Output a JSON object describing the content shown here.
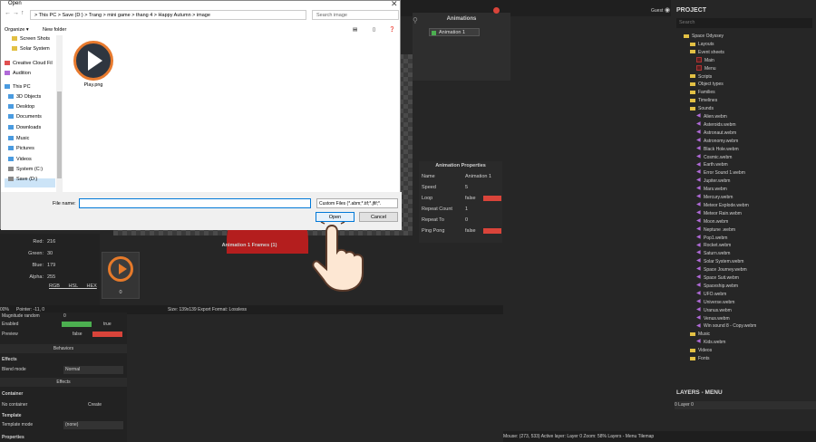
{
  "dialog": {
    "title": "Open",
    "address": "  >  This PC  >  Save (D:)  >  Trang  >  mini game  >  thang 4  >  Happy Autumn  >  image",
    "search_placeholder": "Search image",
    "organize": "Organize ▾",
    "new_folder": "New folder",
    "file_name_label": "File name:",
    "file_type": "Custom Files (*.abm;*.tif;*.jfif;*.",
    "open": "Open",
    "cancel": "Cancel",
    "file": "Play.png"
  },
  "nav_items": [
    "Screen Shots",
    "Solar System",
    "Creative Cloud Fil",
    "Audition",
    "This PC",
    "3D Objects",
    "Desktop",
    "Documents",
    "Downloads",
    "Music",
    "Pictures",
    "Videos",
    "System (C:)",
    "Save (D:)"
  ],
  "animations": {
    "title": "Animations",
    "item": "Animation 1"
  },
  "anim_props": {
    "title": "Animation Properties",
    "rows": [
      [
        "Name",
        "Animation 1"
      ],
      [
        "Speed",
        "5"
      ],
      [
        "Loop",
        "false"
      ],
      [
        "Repeat Count",
        "1"
      ],
      [
        "Repeat To",
        "0"
      ],
      [
        "Ping Pong",
        "false"
      ]
    ]
  },
  "frames": {
    "title": "Animation 1 Frames (1)",
    "frame_num": "0"
  },
  "color": {
    "red_l": "Red:",
    "red": "216",
    "green_l": "Green:",
    "green": "30",
    "blue_l": "Blue:",
    "blue": "179",
    "alpha_l": "Alpha:",
    "alpha": "255",
    "tabs": "RGB HSL HEX"
  },
  "status": {
    "zoom": "00%",
    "pointer": "Pointer: -11, 0",
    "size": "Size: 139x139   Export Format: Lossless"
  },
  "props": {
    "magnitude": "Magnitude random",
    "mag_v": "0",
    "enabled": "Enabled",
    "enabled_v": "true",
    "preview": "Preview",
    "preview_v": "false",
    "behaviors": "Behaviors",
    "effects": "Effects",
    "blend": "Blend mode",
    "blend_v": "Normal",
    "effects2": "Effects",
    "container": "Container",
    "no_container": "No container",
    "create": "Create",
    "template": "Template",
    "template_mode": "Template mode",
    "template_v": "(none)",
    "properties": "Properties"
  },
  "project": {
    "title": "PROJECT",
    "search": "Search",
    "tree": [
      [
        "f",
        0,
        "Space Odyssey"
      ],
      [
        "f",
        1,
        "Layouts"
      ],
      [
        "f",
        1,
        "Event sheets"
      ],
      [
        "l",
        2,
        "Main"
      ],
      [
        "l",
        2,
        "Menu"
      ],
      [
        "f",
        1,
        "Scripts"
      ],
      [
        "f",
        1,
        "Object types"
      ],
      [
        "f",
        1,
        "Families"
      ],
      [
        "f",
        1,
        "Timelines"
      ],
      [
        "f",
        1,
        "Sounds"
      ],
      [
        "s",
        2,
        "Alien.webm"
      ],
      [
        "s",
        2,
        "Asteroids.webm"
      ],
      [
        "s",
        2,
        "Astronaut.webm"
      ],
      [
        "s",
        2,
        "Astronomy.webm"
      ],
      [
        "s",
        2,
        "Black Hole.webm"
      ],
      [
        "s",
        2,
        "Cosmic.webm"
      ],
      [
        "s",
        2,
        "Earth.webm"
      ],
      [
        "s",
        2,
        "Error Sound 1.webm"
      ],
      [
        "s",
        2,
        "Jupiter.webm"
      ],
      [
        "s",
        2,
        "Mars.webm"
      ],
      [
        "s",
        2,
        "Mercury.webm"
      ],
      [
        "s",
        2,
        "Meteor Explode.webm"
      ],
      [
        "s",
        2,
        "Meteor Rain.webm"
      ],
      [
        "s",
        2,
        "Moon.webm"
      ],
      [
        "s",
        2,
        "Neptune .webm"
      ],
      [
        "s",
        2,
        "Pop1.webm"
      ],
      [
        "s",
        2,
        "Rocket.webm"
      ],
      [
        "s",
        2,
        "Saturn.webm"
      ],
      [
        "s",
        2,
        "Solar System.webm"
      ],
      [
        "s",
        2,
        "Space Journey.webm"
      ],
      [
        "s",
        2,
        "Space Suit.webm"
      ],
      [
        "s",
        2,
        "Spaceship.webm"
      ],
      [
        "s",
        2,
        "UFO.webm"
      ],
      [
        "s",
        2,
        "Universe.webm"
      ],
      [
        "s",
        2,
        "Uranus.webm"
      ],
      [
        "s",
        2,
        "Venus.webm"
      ],
      [
        "s",
        2,
        "Win sound 8 - Copy.webm"
      ],
      [
        "f",
        1,
        "Music"
      ],
      [
        "s",
        2,
        "Kids.webm"
      ],
      [
        "f",
        1,
        "Videos"
      ],
      [
        "f",
        1,
        "Fonts"
      ]
    ],
    "layers_title": "LAYERS - MENU",
    "layer0": "0     Layer 0"
  },
  "bottom_status": "Mouse: (273, 533)        Active layer: Layer 0     Zoom: 58%          Layers - Menu          Tilemap",
  "guest": "Guest"
}
